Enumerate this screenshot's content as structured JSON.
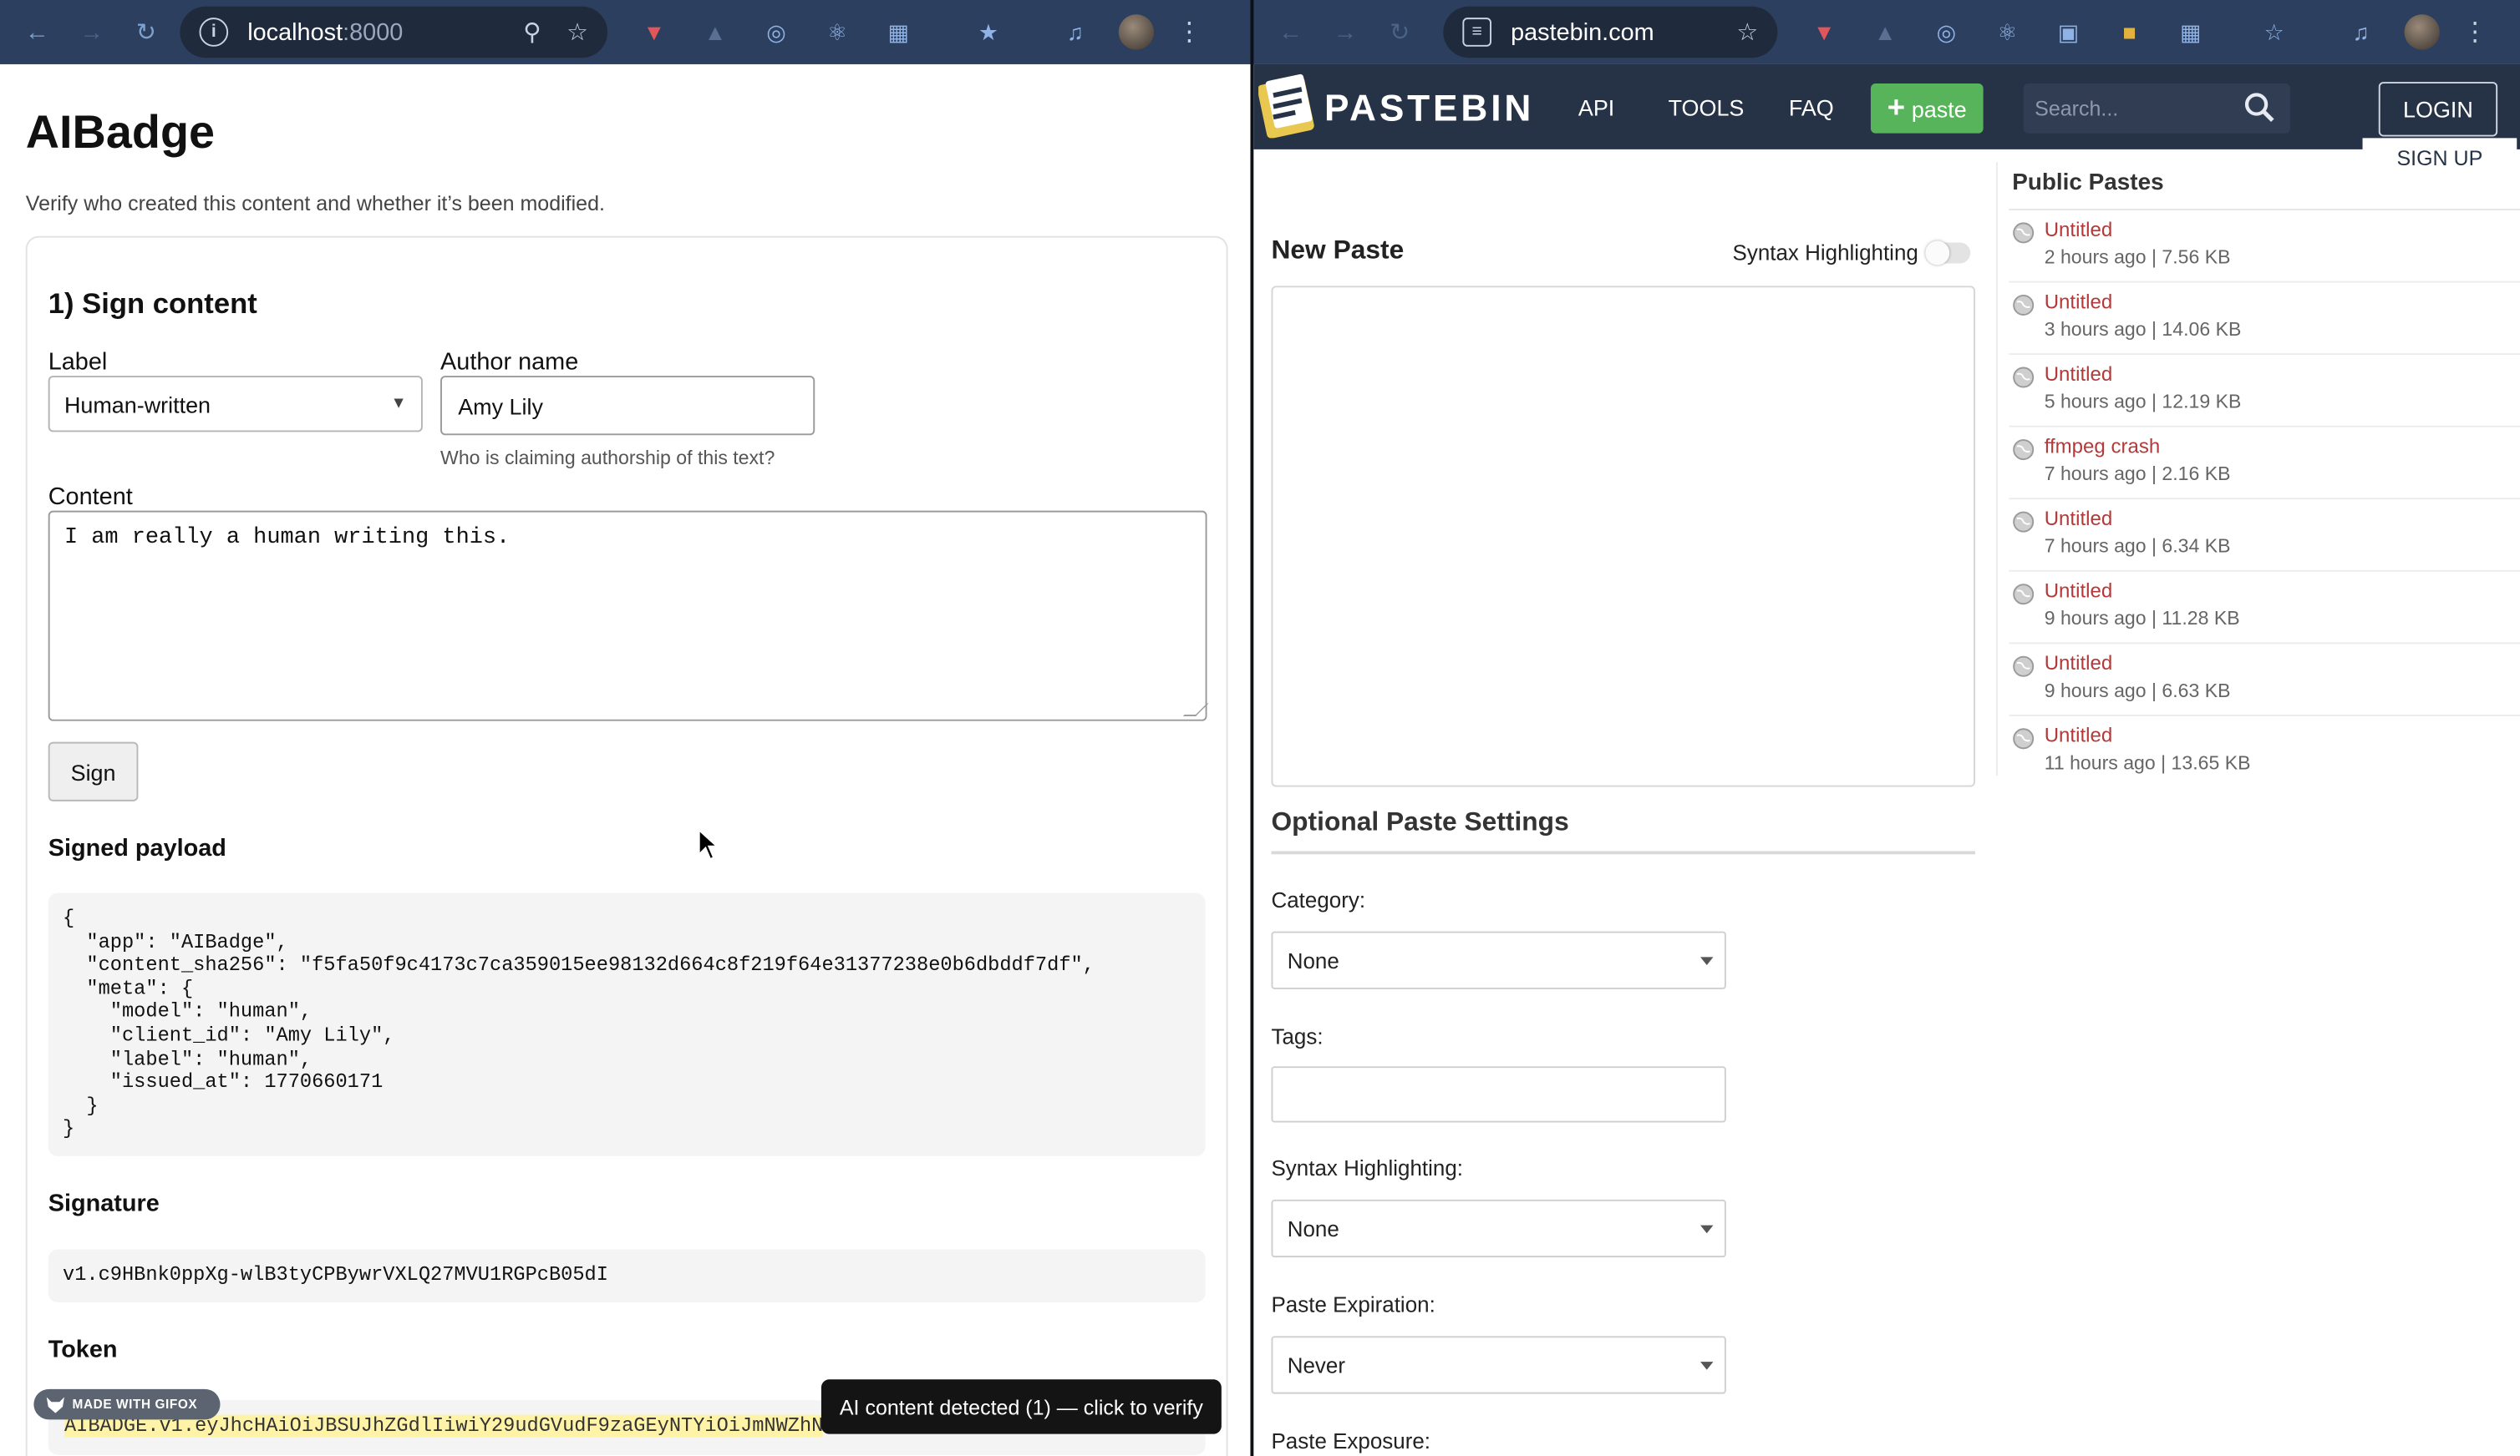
{
  "left_browser": {
    "url_host": "localhost",
    "url_port": ":8000"
  },
  "right_browser": {
    "url": "pastebin.com"
  },
  "app": {
    "title": "AIBadge",
    "subtitle": "Verify who created this content and whether it’s been modified.",
    "sign_section": {
      "heading": "1) Sign content",
      "label_field_label": "Label",
      "label_value": "Human-written",
      "author_label": "Author name",
      "author_value": "Amy Lily",
      "author_hint": "Who is claiming authorship of this text?",
      "content_label": "Content",
      "content_value": "I am really a human writing this.",
      "sign_button": "Sign",
      "payload_title": "Signed payload",
      "payload_json": "{\n  \"app\": \"AIBadge\",\n  \"content_sha256\": \"f5fa50f9c4173c7ca359015ee98132d664c8f219f64e31377238e0b6dbddf7df\",\n  \"meta\": {\n    \"model\": \"human\",\n    \"client_id\": \"Amy Lily\",\n    \"label\": \"human\",\n    \"issued_at\": 1770660171\n  }\n}",
      "signature_title": "Signature",
      "signature_value": "v1.c9HBnk0ppXg-wlB3tyCPBywrVXLQ27MVU1RGPcB05dI",
      "token_title": "Token",
      "token_value": "AIBADGE.v1.eyJhcHAiOiJBSUJhZGdlIiwiY29udGVudF9zaGEyNTYiOiJmNWZhN"
    },
    "toast": "AI content detected (1) — click to verify",
    "gifox_badge": "MADE WITH GIFOX"
  },
  "pastebin": {
    "brand": "PASTEBIN",
    "nav": [
      "API",
      "TOOLS",
      "FAQ"
    ],
    "paste_button": "paste",
    "search_placeholder": "Search...",
    "login": "LOGIN",
    "signup": "SIGN UP",
    "new_paste_title": "New Paste",
    "syntax_toggle_label": "Syntax Highlighting",
    "optional_title": "Optional Paste Settings",
    "category_label": "Category:",
    "category_value": "None",
    "tags_label": "Tags:",
    "syntax_label": "Syntax Highlighting:",
    "syntax_value": "None",
    "expiration_label": "Paste Expiration:",
    "expiration_value": "Never",
    "exposure_label": "Paste Exposure:",
    "public_pastes_title": "Public Pastes",
    "public_pastes": [
      {
        "title": "Untitled",
        "meta": "2 hours ago | 7.56 KB"
      },
      {
        "title": "Untitled",
        "meta": "3 hours ago | 14.06 KB"
      },
      {
        "title": "Untitled",
        "meta": "5 hours ago | 12.19 KB"
      },
      {
        "title": "ffmpeg crash",
        "meta": "7 hours ago | 2.16 KB"
      },
      {
        "title": "Untitled",
        "meta": "7 hours ago | 6.34 KB"
      },
      {
        "title": "Untitled",
        "meta": "9 hours ago | 11.28 KB"
      },
      {
        "title": "Untitled",
        "meta": "9 hours ago | 6.63 KB"
      },
      {
        "title": "Untitled",
        "meta": "11 hours ago | 13.65 KB"
      }
    ]
  },
  "colors": {
    "chrome": "#2c3f5e",
    "pastebin_header": "#263347",
    "paste_button": "#58b45b",
    "paste_link": "#b23a3a",
    "token_highlight": "#fff3a8"
  }
}
